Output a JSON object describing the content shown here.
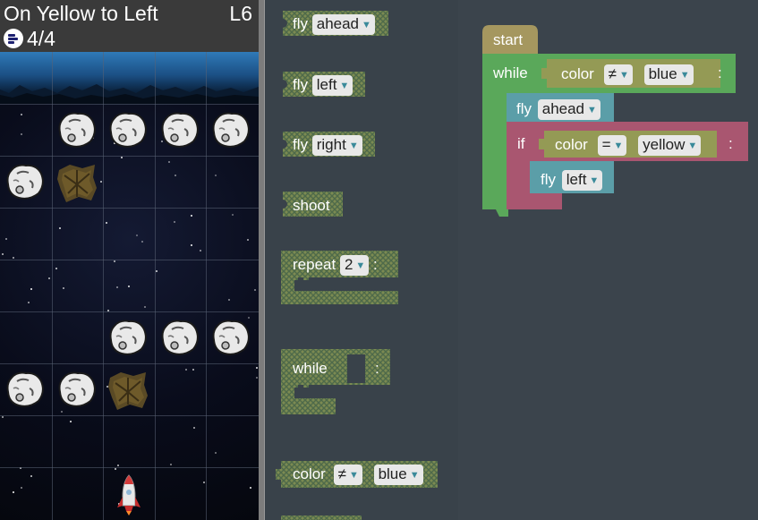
{
  "game": {
    "level_title": "On Yellow to Left",
    "level_number": "L6",
    "line_count": "4/4",
    "icons": {
      "lines": "code-lines-icon",
      "asteroid": "asteroid-icon",
      "yellow_tile": "yellow-cell-icon",
      "ship": "rocket-ship-icon"
    },
    "grid": {
      "rows": 9,
      "cols": 5,
      "asteroids": [
        [
          1,
          1
        ],
        [
          1,
          2
        ],
        [
          1,
          3
        ],
        [
          1,
          4
        ],
        [
          2,
          0
        ],
        [
          5,
          2
        ],
        [
          5,
          3
        ],
        [
          5,
          4
        ],
        [
          6,
          0
        ],
        [
          6,
          1
        ]
      ],
      "yellow_cells": [
        [
          2,
          1
        ],
        [
          6,
          2
        ]
      ],
      "ship": [
        8,
        2
      ]
    }
  },
  "toolbox": {
    "fly_ahead": {
      "keyword": "fly",
      "value": "ahead"
    },
    "fly_left": {
      "keyword": "fly",
      "value": "left"
    },
    "fly_right": {
      "keyword": "fly",
      "value": "right"
    },
    "shoot": "shoot",
    "repeat": {
      "keyword": "repeat",
      "value": "2",
      "colon": ":"
    },
    "while": {
      "keyword": "while",
      "colon": ":"
    },
    "color_cond": {
      "keyword": "color",
      "op": "≠",
      "value": "blue"
    }
  },
  "workspace": {
    "start": "start",
    "while": {
      "keyword": "while",
      "cond_keyword": "color",
      "op": "≠",
      "value": "blue",
      "colon": ":"
    },
    "fly1": {
      "keyword": "fly",
      "value": "ahead"
    },
    "if": {
      "keyword": "if",
      "cond_keyword": "color",
      "op": "=",
      "value": "yellow",
      "colon": ":"
    },
    "fly2": {
      "keyword": "fly",
      "value": "left"
    }
  },
  "colors": {
    "fly_block": "#5b9ea8",
    "while_block": "#5aa85a",
    "if_block": "#a95670",
    "start_block": "#a5975f",
    "condition_block": "#949a55",
    "disabled_hatch": "#7a8a50"
  }
}
